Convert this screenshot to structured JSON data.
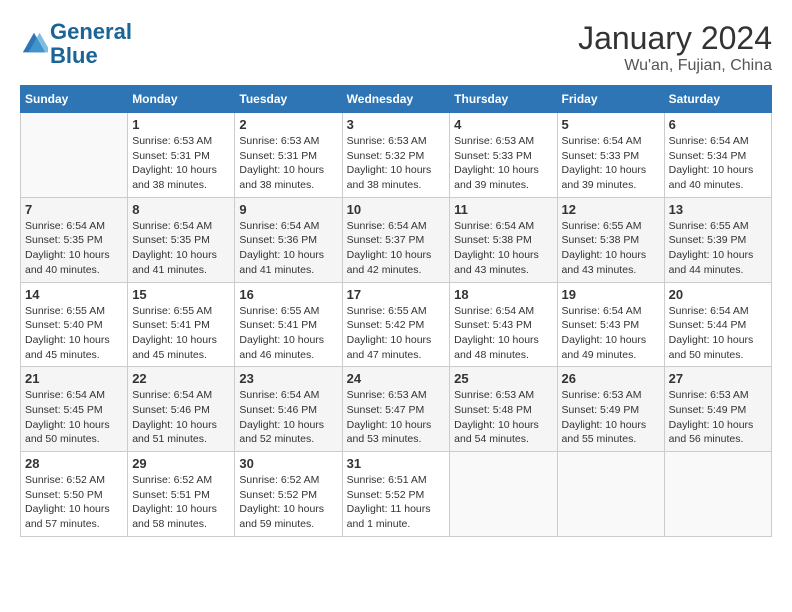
{
  "header": {
    "logo_line1": "General",
    "logo_line2": "Blue",
    "month_year": "January 2024",
    "location": "Wu'an, Fujian, China"
  },
  "days_of_week": [
    "Sunday",
    "Monday",
    "Tuesday",
    "Wednesday",
    "Thursday",
    "Friday",
    "Saturday"
  ],
  "weeks": [
    [
      {
        "day": "",
        "info": ""
      },
      {
        "day": "1",
        "info": "Sunrise: 6:53 AM\nSunset: 5:31 PM\nDaylight: 10 hours\nand 38 minutes."
      },
      {
        "day": "2",
        "info": "Sunrise: 6:53 AM\nSunset: 5:31 PM\nDaylight: 10 hours\nand 38 minutes."
      },
      {
        "day": "3",
        "info": "Sunrise: 6:53 AM\nSunset: 5:32 PM\nDaylight: 10 hours\nand 38 minutes."
      },
      {
        "day": "4",
        "info": "Sunrise: 6:53 AM\nSunset: 5:33 PM\nDaylight: 10 hours\nand 39 minutes."
      },
      {
        "day": "5",
        "info": "Sunrise: 6:54 AM\nSunset: 5:33 PM\nDaylight: 10 hours\nand 39 minutes."
      },
      {
        "day": "6",
        "info": "Sunrise: 6:54 AM\nSunset: 5:34 PM\nDaylight: 10 hours\nand 40 minutes."
      }
    ],
    [
      {
        "day": "7",
        "info": "Sunrise: 6:54 AM\nSunset: 5:35 PM\nDaylight: 10 hours\nand 40 minutes."
      },
      {
        "day": "8",
        "info": "Sunrise: 6:54 AM\nSunset: 5:35 PM\nDaylight: 10 hours\nand 41 minutes."
      },
      {
        "day": "9",
        "info": "Sunrise: 6:54 AM\nSunset: 5:36 PM\nDaylight: 10 hours\nand 41 minutes."
      },
      {
        "day": "10",
        "info": "Sunrise: 6:54 AM\nSunset: 5:37 PM\nDaylight: 10 hours\nand 42 minutes."
      },
      {
        "day": "11",
        "info": "Sunrise: 6:54 AM\nSunset: 5:38 PM\nDaylight: 10 hours\nand 43 minutes."
      },
      {
        "day": "12",
        "info": "Sunrise: 6:55 AM\nSunset: 5:38 PM\nDaylight: 10 hours\nand 43 minutes."
      },
      {
        "day": "13",
        "info": "Sunrise: 6:55 AM\nSunset: 5:39 PM\nDaylight: 10 hours\nand 44 minutes."
      }
    ],
    [
      {
        "day": "14",
        "info": "Sunrise: 6:55 AM\nSunset: 5:40 PM\nDaylight: 10 hours\nand 45 minutes."
      },
      {
        "day": "15",
        "info": "Sunrise: 6:55 AM\nSunset: 5:41 PM\nDaylight: 10 hours\nand 45 minutes."
      },
      {
        "day": "16",
        "info": "Sunrise: 6:55 AM\nSunset: 5:41 PM\nDaylight: 10 hours\nand 46 minutes."
      },
      {
        "day": "17",
        "info": "Sunrise: 6:55 AM\nSunset: 5:42 PM\nDaylight: 10 hours\nand 47 minutes."
      },
      {
        "day": "18",
        "info": "Sunrise: 6:54 AM\nSunset: 5:43 PM\nDaylight: 10 hours\nand 48 minutes."
      },
      {
        "day": "19",
        "info": "Sunrise: 6:54 AM\nSunset: 5:43 PM\nDaylight: 10 hours\nand 49 minutes."
      },
      {
        "day": "20",
        "info": "Sunrise: 6:54 AM\nSunset: 5:44 PM\nDaylight: 10 hours\nand 50 minutes."
      }
    ],
    [
      {
        "day": "21",
        "info": "Sunrise: 6:54 AM\nSunset: 5:45 PM\nDaylight: 10 hours\nand 50 minutes."
      },
      {
        "day": "22",
        "info": "Sunrise: 6:54 AM\nSunset: 5:46 PM\nDaylight: 10 hours\nand 51 minutes."
      },
      {
        "day": "23",
        "info": "Sunrise: 6:54 AM\nSunset: 5:46 PM\nDaylight: 10 hours\nand 52 minutes."
      },
      {
        "day": "24",
        "info": "Sunrise: 6:53 AM\nSunset: 5:47 PM\nDaylight: 10 hours\nand 53 minutes."
      },
      {
        "day": "25",
        "info": "Sunrise: 6:53 AM\nSunset: 5:48 PM\nDaylight: 10 hours\nand 54 minutes."
      },
      {
        "day": "26",
        "info": "Sunrise: 6:53 AM\nSunset: 5:49 PM\nDaylight: 10 hours\nand 55 minutes."
      },
      {
        "day": "27",
        "info": "Sunrise: 6:53 AM\nSunset: 5:49 PM\nDaylight: 10 hours\nand 56 minutes."
      }
    ],
    [
      {
        "day": "28",
        "info": "Sunrise: 6:52 AM\nSunset: 5:50 PM\nDaylight: 10 hours\nand 57 minutes."
      },
      {
        "day": "29",
        "info": "Sunrise: 6:52 AM\nSunset: 5:51 PM\nDaylight: 10 hours\nand 58 minutes."
      },
      {
        "day": "30",
        "info": "Sunrise: 6:52 AM\nSunset: 5:52 PM\nDaylight: 10 hours\nand 59 minutes."
      },
      {
        "day": "31",
        "info": "Sunrise: 6:51 AM\nSunset: 5:52 PM\nDaylight: 11 hours\nand 1 minute."
      },
      {
        "day": "",
        "info": ""
      },
      {
        "day": "",
        "info": ""
      },
      {
        "day": "",
        "info": ""
      }
    ]
  ]
}
